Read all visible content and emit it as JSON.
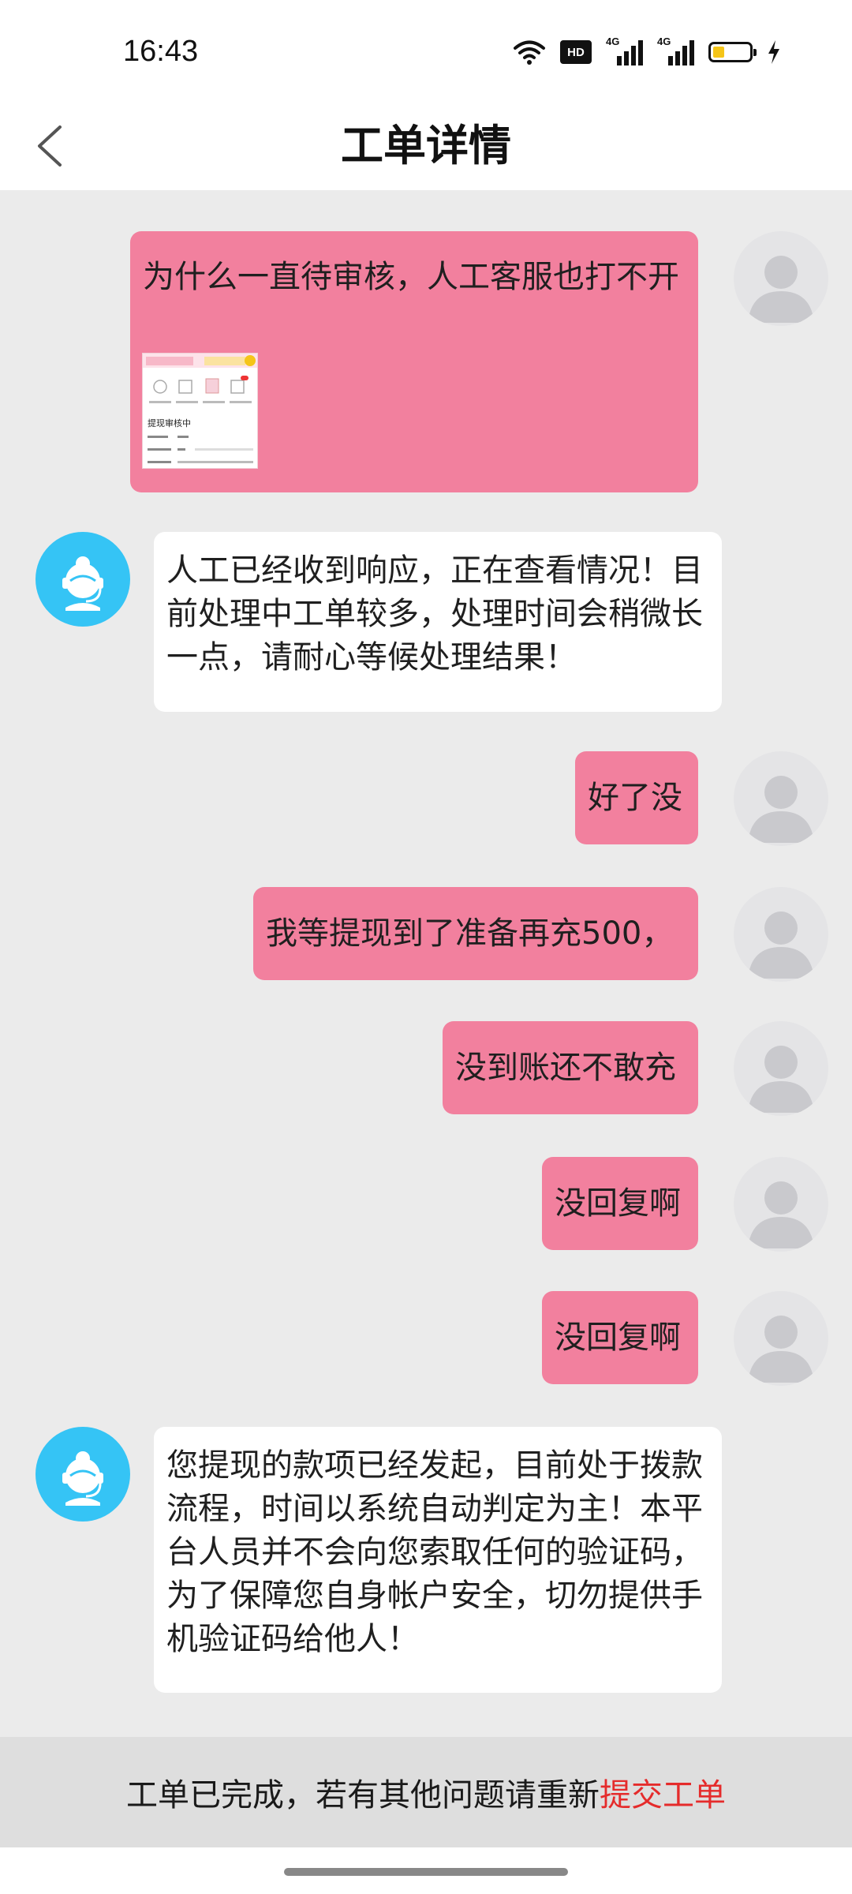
{
  "status_bar": {
    "time": "16:43",
    "hd_label": "HD",
    "network_1": "4G",
    "network_2": "4G",
    "icons": [
      "wifi-icon",
      "hd-icon",
      "signal-4g-icon",
      "signal-4g-icon",
      "battery-low-icon",
      "charging-icon"
    ]
  },
  "header": {
    "title": "工单详情",
    "back_icon": "chevron-left-icon"
  },
  "messages": [
    {
      "sender": "user",
      "text": "为什么一直待审核，人工客服也打不开",
      "attachment": {
        "mini_title": "提现审核中"
      }
    },
    {
      "sender": "agent",
      "text": "人工已经收到响应，正在查看情况！目前处理中工单较多，处理时间会稍微长一点，请耐心等候处理结果！"
    },
    {
      "sender": "user",
      "text": "好了没"
    },
    {
      "sender": "user",
      "text": "我等提现到了准备再充500，"
    },
    {
      "sender": "user",
      "text": "没到账还不敢充"
    },
    {
      "sender": "user",
      "text": "没回复啊"
    },
    {
      "sender": "user",
      "text": "没回复啊"
    },
    {
      "sender": "agent",
      "text": "您提现的款项已经发起，目前处于拨款流程，时间以系统自动判定为主！本平台人员并不会向您索取任何的验证码，为了保障您自身帐户安全，切勿提供手机验证码给他人！"
    }
  ],
  "footer": {
    "notice": "工单已完成，若有其他问题请重新",
    "link": "提交工单"
  },
  "colors": {
    "user_bubble": "#f2809e",
    "agent_bubble": "#ffffff",
    "chat_background": "#ebebeb",
    "agent_avatar": "#35c4f5",
    "footer_link": "#e52b2b"
  }
}
